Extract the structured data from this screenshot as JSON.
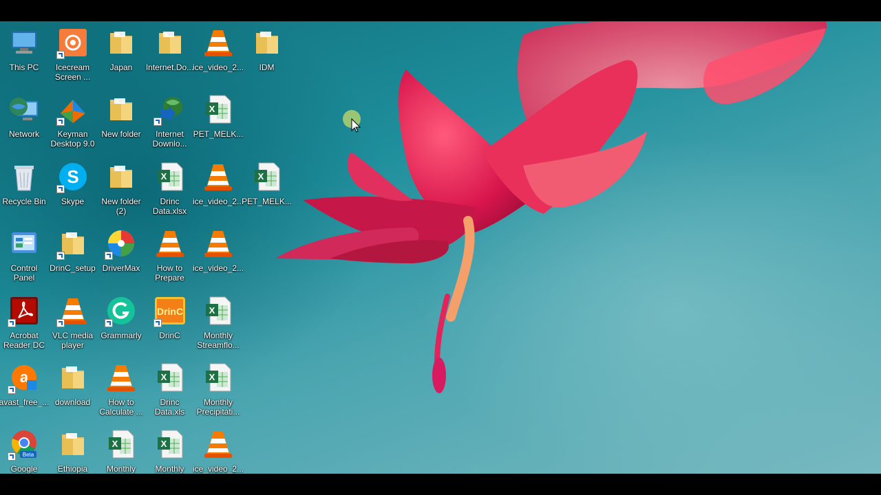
{
  "desktop": {
    "icons": [
      {
        "label": "This PC",
        "icon": "computer-icon"
      },
      {
        "label": "Icecream\nScreen ...",
        "icon": "icecream-recorder-icon"
      },
      {
        "label": "Japan",
        "icon": "folder-icon"
      },
      {
        "label": "Internet.Do...",
        "icon": "folder-icon"
      },
      {
        "label": "ice_video_2...",
        "icon": "vlc-file-icon"
      },
      {
        "label": "IDM",
        "icon": "folder-icon"
      },
      {
        "label": "Network",
        "icon": "network-icon"
      },
      {
        "label": "Keyman\nDesktop 9.0",
        "icon": "keyman-icon"
      },
      {
        "label": "New folder",
        "icon": "folder-icon"
      },
      {
        "label": "Internet\nDownlo...",
        "icon": "idm-icon"
      },
      {
        "label": "PET_MELK...",
        "icon": "excel-file-icon"
      },
      {
        "label": "Recycle Bin",
        "icon": "recycle-bin-icon"
      },
      {
        "label": "Skype",
        "icon": "skype-icon"
      },
      {
        "label": "New folder\n(2)",
        "icon": "folder-icon"
      },
      {
        "label": "Drinc\nData.xlsx",
        "icon": "excel-file-icon"
      },
      {
        "label": "ice_video_2...",
        "icon": "vlc-file-icon"
      },
      {
        "label": "PET_MELK...",
        "icon": "excel-file-icon"
      },
      {
        "label": "Control\nPanel",
        "icon": "control-panel-icon"
      },
      {
        "label": "DrinC_setup",
        "icon": "folder-icon"
      },
      {
        "label": "DriverMax",
        "icon": "drivermax-icon"
      },
      {
        "label": "How to\nPrepare Dat...",
        "icon": "vlc-file-icon"
      },
      {
        "label": "ice_video_2...",
        "icon": "vlc-file-icon"
      },
      {
        "label": "Acrobat\nReader DC",
        "icon": "acrobat-icon"
      },
      {
        "label": "VLC media\nplayer",
        "icon": "vlc-icon"
      },
      {
        "label": "Grammarly",
        "icon": "grammarly-icon"
      },
      {
        "label": "DrinC",
        "icon": "drinc-icon"
      },
      {
        "label": "Monthly\nStreamflo...",
        "icon": "excel-file-icon"
      },
      {
        "label": "avast_free_...",
        "icon": "avast-icon"
      },
      {
        "label": "download",
        "icon": "folder-icon"
      },
      {
        "label": "How to\nCalculate ...",
        "icon": "vlc-file-icon"
      },
      {
        "label": "Drinc Data.xls",
        "icon": "excel-file-icon"
      },
      {
        "label": "Monthly\nPrecipitati...",
        "icon": "excel-file-icon"
      },
      {
        "label": "Google\nChrome Beta",
        "icon": "chrome-beta-icon"
      },
      {
        "label": "Ethiopia",
        "icon": "folder-icon"
      },
      {
        "label": "Monthly\nMean M...",
        "icon": "excel-file-icon"
      },
      {
        "label": "Monthly\nMean M...",
        "icon": "excel-file-icon"
      },
      {
        "label": "ice_video_2...",
        "icon": "vlc-file-icon"
      }
    ]
  },
  "colors": {
    "wallpaper_teal": "#1f8f9c",
    "flower_red": "#d81b50",
    "letterbox": "#000000"
  }
}
